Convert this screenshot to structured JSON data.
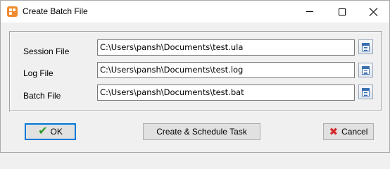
{
  "window": {
    "title": "Create Batch File",
    "icons": {
      "app": "batch-app-icon",
      "minimize": "minimize-icon",
      "maximize": "maximize-icon",
      "close": "close-icon"
    }
  },
  "form": {
    "session_file": {
      "label": "Session File",
      "value": "C:\\Users\\pansh\\Documents\\test.ula",
      "browse_icon": "browse-file-icon"
    },
    "log_file": {
      "label": "Log File",
      "value": "C:\\Users\\pansh\\Documents\\test.log",
      "browse_icon": "browse-file-icon"
    },
    "batch_file": {
      "label": "Batch File",
      "value": "C:\\Users\\pansh\\Documents\\test.bat",
      "browse_icon": "browse-file-icon"
    }
  },
  "buttons": {
    "ok_label": "OK",
    "schedule_label": "Create & Schedule Task",
    "cancel_label": "Cancel"
  },
  "colors": {
    "accent": "#0078d7",
    "app_icon": "#f08a2c",
    "ok_icon": "#2f9a2a",
    "cancel_icon": "#d42a2a"
  }
}
